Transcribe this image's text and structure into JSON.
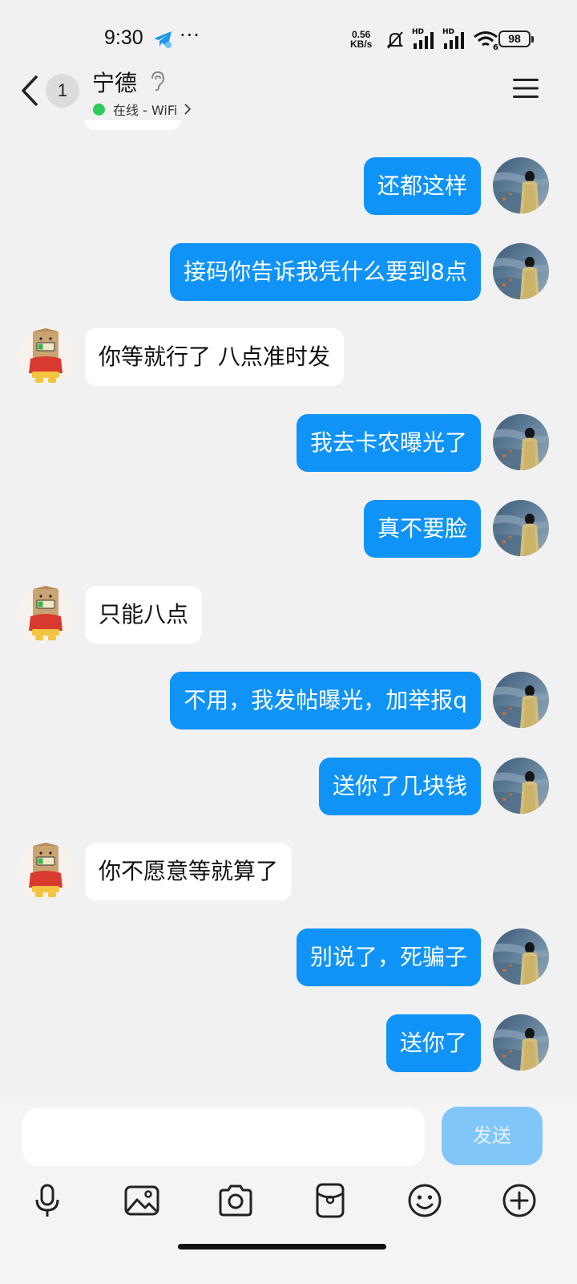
{
  "status_bar": {
    "time": "9:30",
    "more": "···",
    "net_speed_value": "0.56",
    "net_speed_unit": "KB/s",
    "signal_1_label": "HD",
    "signal_2_label": "HD",
    "wifi_label": "6",
    "battery": "98"
  },
  "header": {
    "unread_count": "1",
    "contact_name": "宁德",
    "online_status": "在线 - WiFi"
  },
  "messages": [
    {
      "side": "out",
      "text": "还都这样"
    },
    {
      "side": "out",
      "text": "接码你告诉我凭什么要到8点"
    },
    {
      "side": "in",
      "text": "你等就行了 八点准时发"
    },
    {
      "side": "out",
      "text": "我去卡农曝光了"
    },
    {
      "side": "out",
      "text": "真不要脸"
    },
    {
      "side": "in",
      "text": "只能八点"
    },
    {
      "side": "out",
      "text": "不用，我发帖曝光，加举报q"
    },
    {
      "side": "out",
      "text": "送你了几块钱"
    },
    {
      "side": "in",
      "text": "你不愿意等就算了"
    },
    {
      "side": "out",
      "text": "别说了，死骗子"
    },
    {
      "side": "out",
      "text": "送你了"
    }
  ],
  "composer": {
    "input_value": "",
    "send_label": "发送"
  },
  "toolbar": [
    "microphone-icon",
    "image-icon",
    "camera-icon",
    "red-packet-icon",
    "emoji-icon",
    "plus-icon"
  ],
  "colors": {
    "outgoing_bubble": "#0f93f7",
    "incoming_bubble": "#ffffff",
    "send_button_disabled": "#80c6f9",
    "online_dot": "#2ecc5a",
    "background": "#f1f1f1"
  }
}
